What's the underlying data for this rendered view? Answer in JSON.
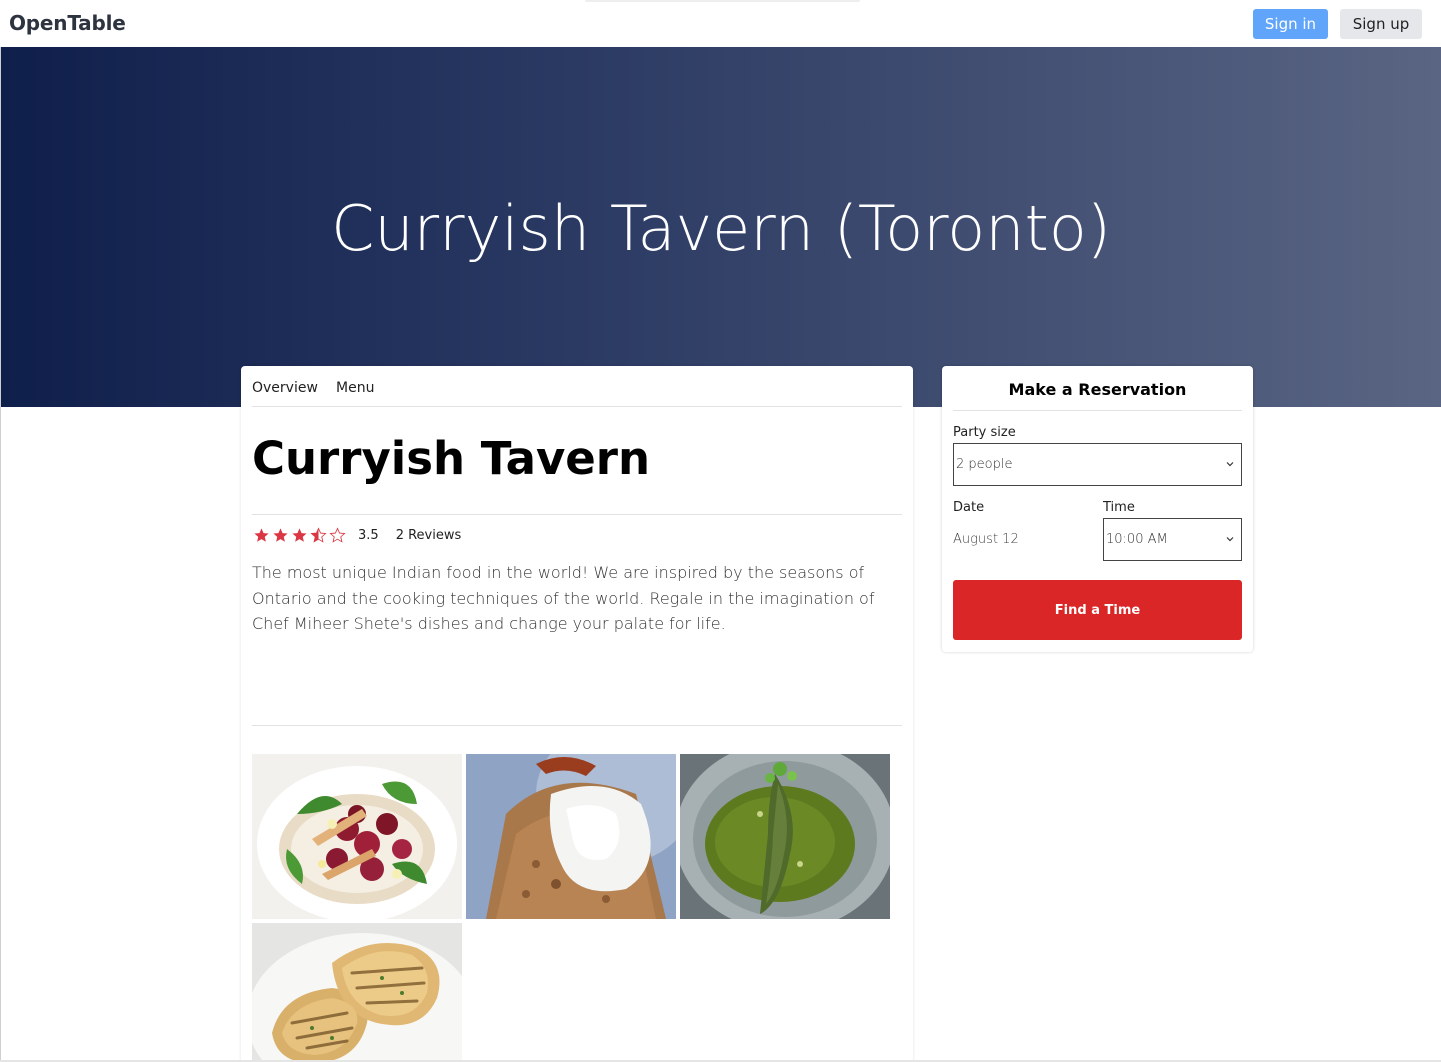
{
  "navbar": {
    "brand": "OpenTable",
    "sign_in": "Sign in",
    "sign_up": "Sign up"
  },
  "hero": {
    "title": "Curryish Tavern (Toronto)"
  },
  "restaurant": {
    "tabs": [
      "Overview",
      "Menu"
    ],
    "name": "Curryish Tavern",
    "rating": "3.5",
    "rating_value": 3.5,
    "reviews": "2 Reviews",
    "description": "The most unique Indian food in the world! We are inspired by the seasons of Ontario and the cooking techniques of the world. Regale in the imagination of Chef Miheer Shete's dishes and change your palate for life.",
    "photos": [
      "beet-salad-photo",
      "poached-egg-crumble-photo",
      "green-curry-fish-photo",
      "naan-bread-photo"
    ]
  },
  "reservation": {
    "title": "Make a Reservation",
    "party_label": "Party size",
    "party_value": "2 people",
    "date_label": "Date",
    "date_value": "August 12",
    "time_label": "Time",
    "time_value": "10:00 AM",
    "button": "Find a Time"
  },
  "colors": {
    "accent_red": "#da2626",
    "star_red": "#da3743",
    "signin_blue": "#60a5fa",
    "hero_start": "#0f1f4b",
    "hero_end": "#5a6583"
  }
}
